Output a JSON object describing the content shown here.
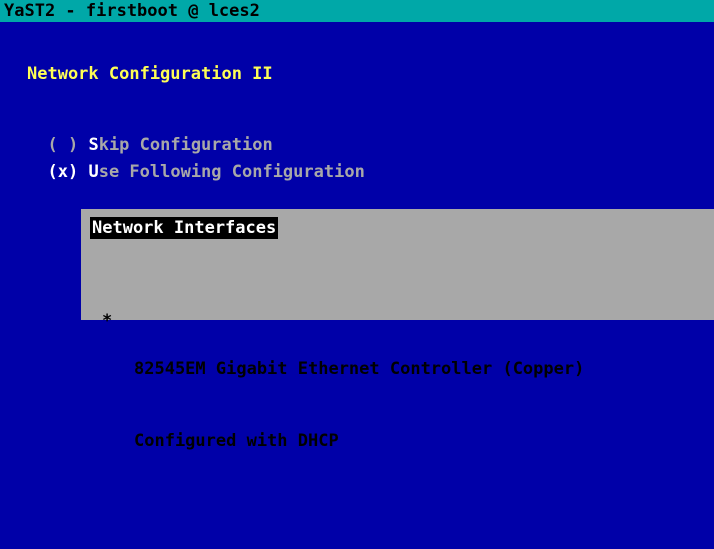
{
  "window": {
    "title": "YaST2 - firstboot @ lces2"
  },
  "dialog": {
    "title": "Network Configuration II",
    "options": [
      {
        "mark": "( )",
        "hotkey": "S",
        "rest": "kip Configuration",
        "selected": false
      },
      {
        "mark": "(x)",
        "hotkey": "U",
        "rest": "se Following Configuration",
        "selected": true
      }
    ]
  },
  "interfaces": {
    "title": "Network Interfaces",
    "items": [
      {
        "bullet": "*",
        "name": "82545EM Gigabit Ethernet Controller (Copper)",
        "status": "Configured with DHCP"
      }
    ]
  },
  "colors": {
    "background": "#0000a8",
    "titlebar": "#00a8a8",
    "heading": "#ffff55",
    "text": "#a8a8a8",
    "hotkey": "#ffffff",
    "frame": "#a8a8a8"
  }
}
